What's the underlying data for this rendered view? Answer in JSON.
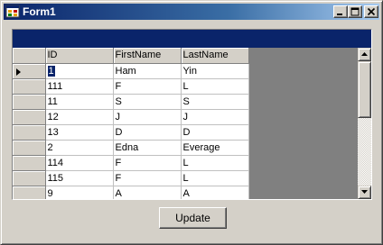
{
  "window": {
    "title": "Form1",
    "background": "#d4d0c8",
    "title_gradient": [
      "#0a246a",
      "#a6caf0"
    ]
  },
  "icons": {
    "app": "form-app-icon",
    "minimize": "minimize-icon",
    "maximize": "maximize-icon",
    "close": "close-icon",
    "row_indicator": "row-pointer-icon",
    "scroll_up": "scroll-up-arrow-icon",
    "scroll_down": "scroll-down-arrow-icon"
  },
  "grid": {
    "caption_color": "#0a246a",
    "columns": [
      "ID",
      "FirstName",
      "LastName"
    ],
    "rows": [
      {
        "id": "1",
        "first": "Ham",
        "last": "Yin"
      },
      {
        "id": "111",
        "first": "F",
        "last": "L"
      },
      {
        "id": "11",
        "first": "S",
        "last": "S"
      },
      {
        "id": "12",
        "first": "J",
        "last": "J"
      },
      {
        "id": "13",
        "first": "D",
        "last": "D"
      },
      {
        "id": "2",
        "first": "Edna",
        "last": "Everage"
      },
      {
        "id": "114",
        "first": "F",
        "last": "L"
      },
      {
        "id": "115",
        "first": "F",
        "last": "L"
      },
      {
        "id": "9",
        "first": "A",
        "last": "A"
      }
    ]
  },
  "buttons": {
    "update": "Update"
  }
}
